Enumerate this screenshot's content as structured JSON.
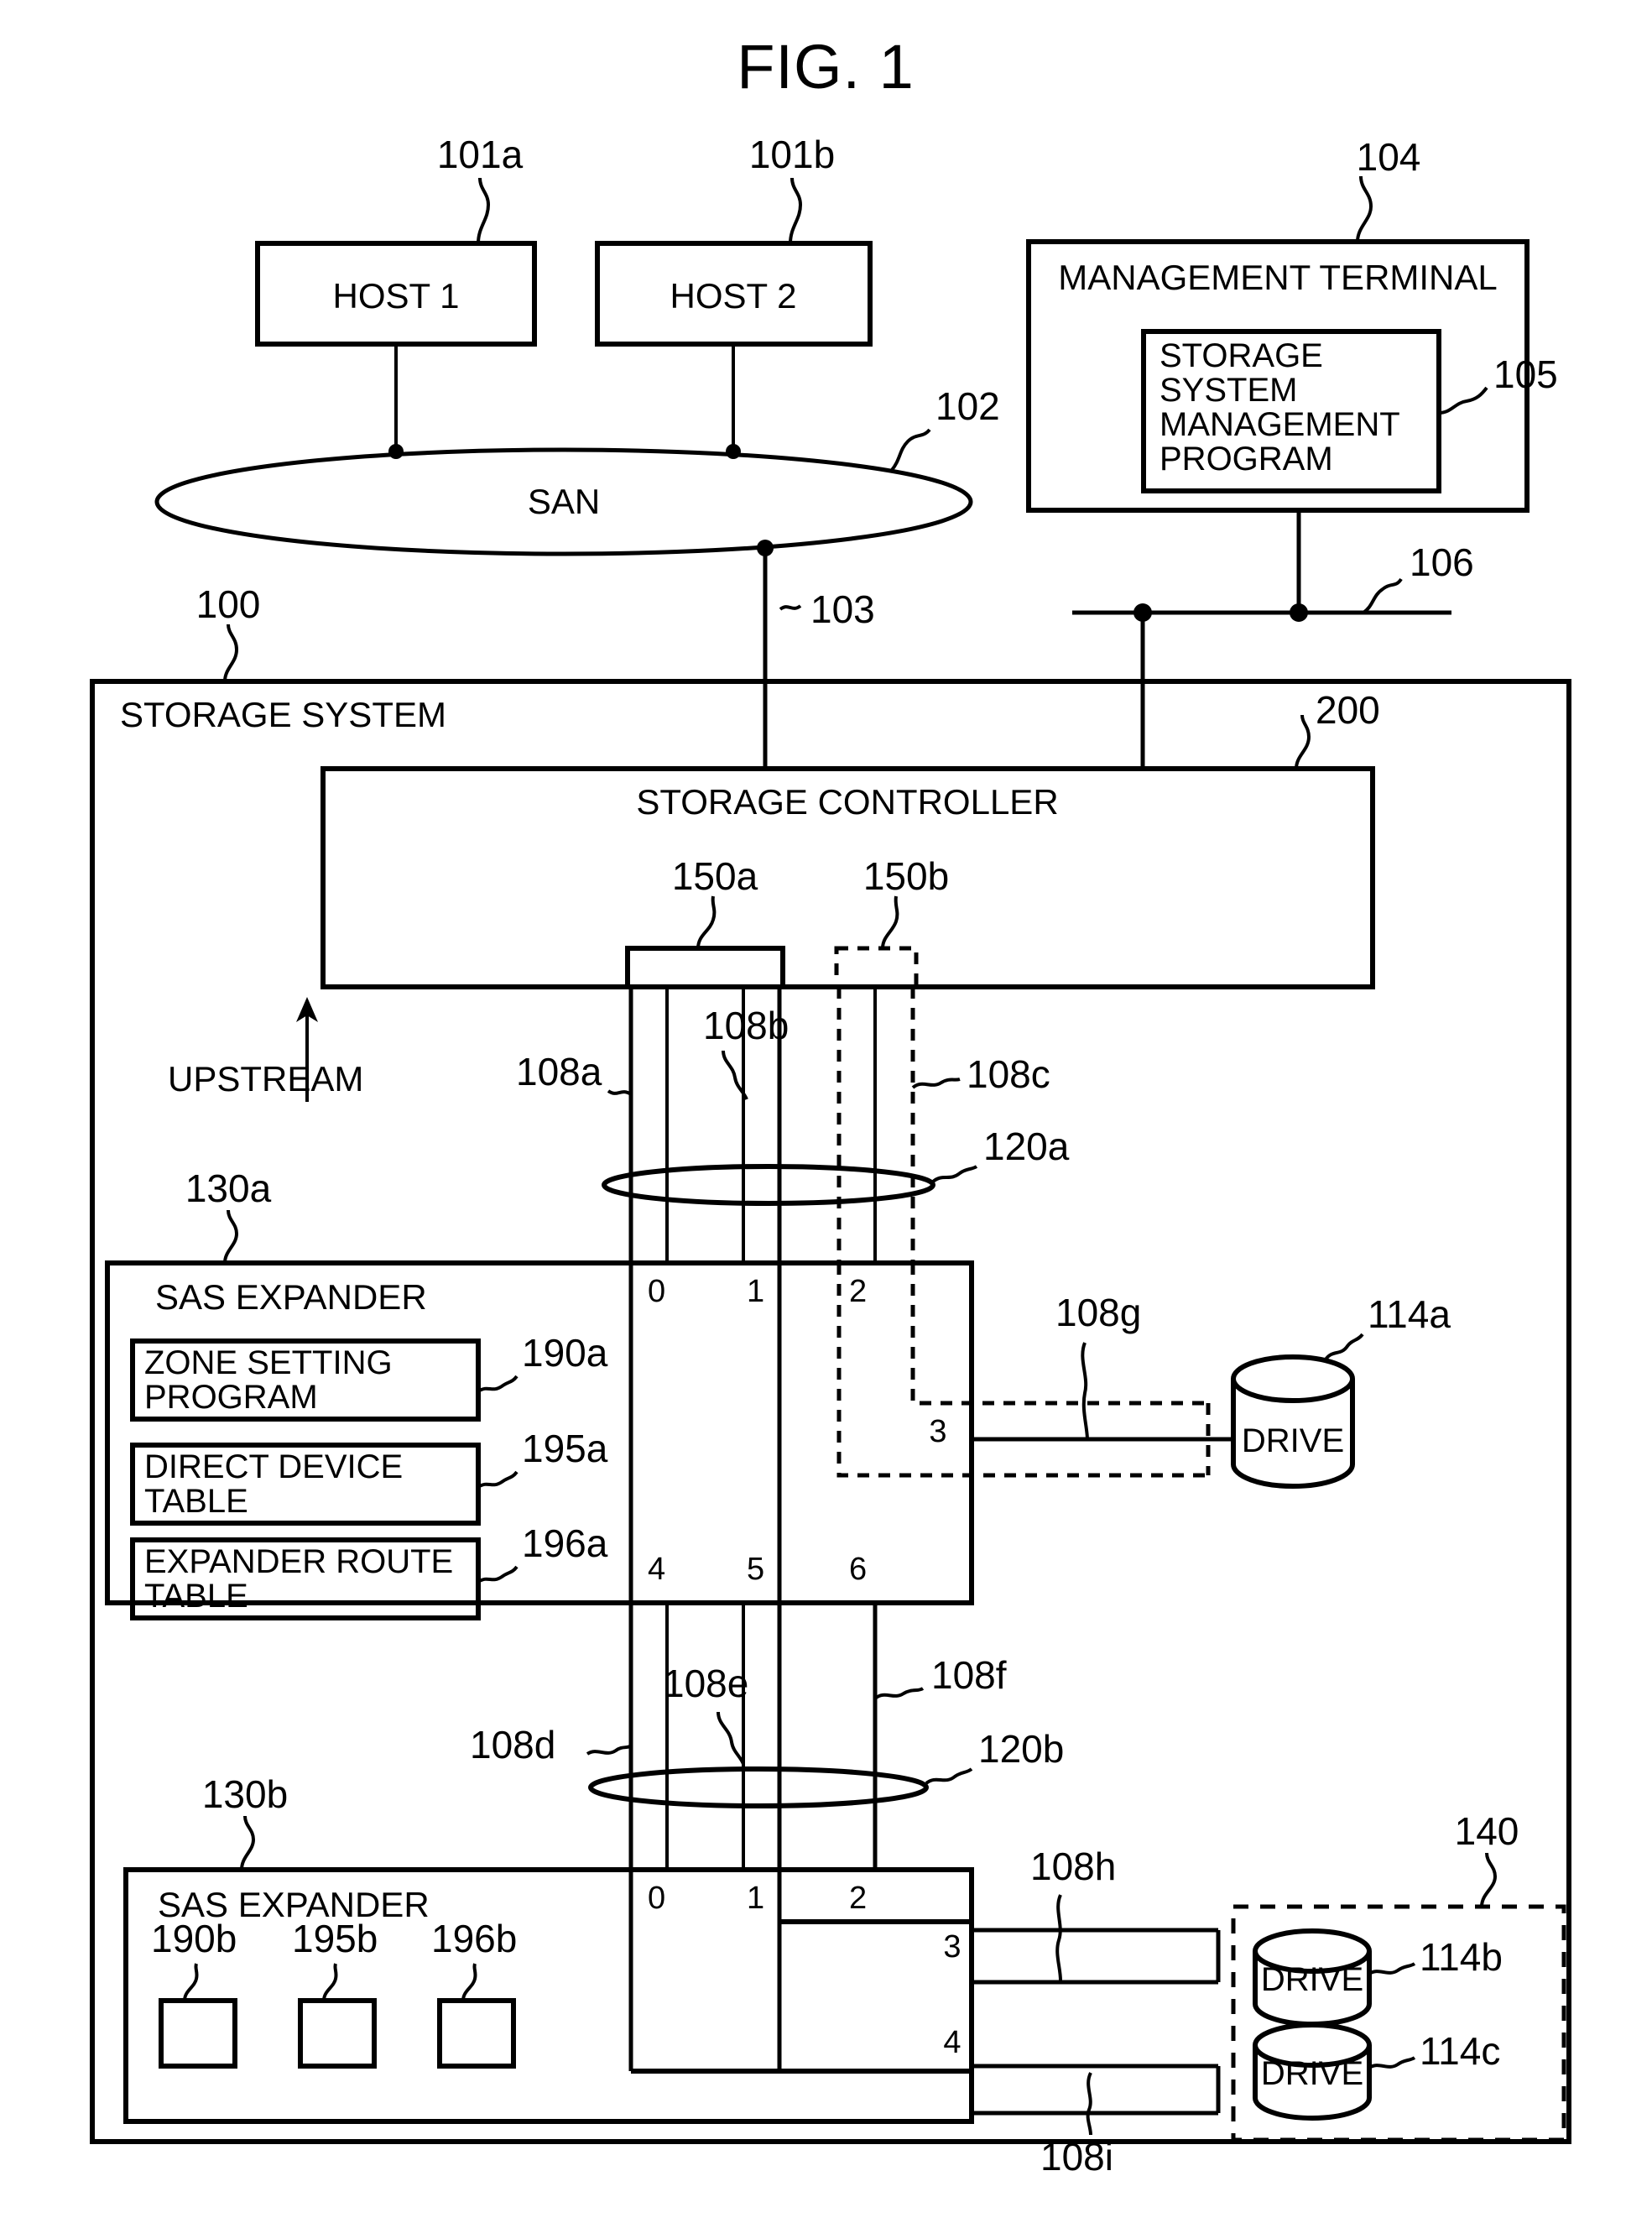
{
  "figure": {
    "title": "FIG. 1",
    "domain": "patent-diagram"
  },
  "nodes": {
    "host1": {
      "label": "HOST 1",
      "ref": "101a"
    },
    "host2": {
      "label": "HOST 2",
      "ref": "101b"
    },
    "san": {
      "label": "SAN",
      "ref": "102"
    },
    "san_link": {
      "ref": "103"
    },
    "mgmt_terminal": {
      "label": "MANAGEMENT TERMINAL",
      "ref": "104"
    },
    "mgmt_program": {
      "label": "STORAGE SYSTEM MANAGEMENT PROGRAM",
      "line1": "STORAGE",
      "line2": "SYSTEM",
      "line3": "MANAGEMENT",
      "line4": "PROGRAM",
      "ref": "105"
    },
    "mgmt_network": {
      "ref": "106"
    },
    "storage_system": {
      "label": "STORAGE SYSTEM",
      "ref": "100"
    },
    "storage_controller": {
      "label": "STORAGE  CONTROLLER",
      "ref": "200"
    },
    "port_block_a": {
      "ref": "150a"
    },
    "port_block_b": {
      "ref": "150b"
    },
    "upstream": {
      "label": "UPSTREAM"
    },
    "expander_a": {
      "label": "SAS EXPANDER",
      "ref": "130a"
    },
    "expander_b": {
      "label": "SAS EXPANDER",
      "ref": "130b"
    },
    "zone_setting_program_a": {
      "line1": "ZONE SETTING",
      "line2": "PROGRAM",
      "ref": "190a"
    },
    "direct_device_table_a": {
      "line1": "DIRECT DEVICE",
      "line2": "TABLE",
      "ref": "195a"
    },
    "expander_route_table_a": {
      "line1": "EXPANDER ROUTE",
      "line2": "TABLE",
      "ref": "196a"
    },
    "zone_setting_program_b": {
      "ref": "190b"
    },
    "direct_device_table_b": {
      "ref": "195b"
    },
    "expander_route_table_b": {
      "ref": "196b"
    },
    "drive_a": {
      "label": "DRIVE",
      "ref": "114a"
    },
    "drive_b": {
      "label": "DRIVE",
      "ref": "114b"
    },
    "drive_c": {
      "label": "DRIVE",
      "ref": "114c"
    },
    "drive_enclosure": {
      "ref": "140"
    },
    "zone_group_a": {
      "ref": "120a"
    },
    "zone_group_b": {
      "ref": "120b"
    }
  },
  "links": {
    "l108a": "108a",
    "l108b": "108b",
    "l108c": "108c",
    "l108d": "108d",
    "l108e": "108e",
    "l108f": "108f",
    "l108g": "108g",
    "l108h": "108h",
    "l108i": "108i"
  },
  "ports": {
    "expander_a_top": [
      "0",
      "1",
      "2"
    ],
    "expander_a_right": [
      "3"
    ],
    "expander_a_bottom": [
      "4",
      "5",
      "6"
    ],
    "expander_b_top": [
      "0",
      "1",
      "2"
    ],
    "expander_b_right": [
      "3",
      "4"
    ]
  },
  "colors": {
    "line": "#000000",
    "background": "#ffffff"
  }
}
